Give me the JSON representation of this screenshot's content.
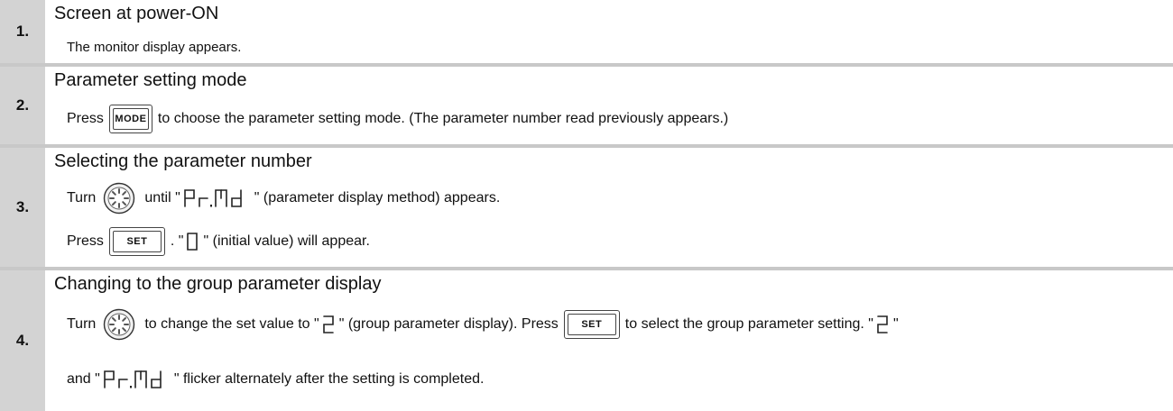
{
  "steps": [
    {
      "number": "1.",
      "title": "Screen at power-ON",
      "text": "The monitor display appears."
    },
    {
      "number": "2.",
      "title": "Parameter setting mode",
      "press_word": "Press",
      "button": "MODE",
      "text_after": "to choose the parameter setting mode. (The parameter number read previously appears.)"
    },
    {
      "number": "3.",
      "title": "Selecting the parameter number",
      "line1": {
        "turn_word": "Turn",
        "until_word": "until",
        "display": "Pr.Md",
        "text_after": "(parameter display method) appears."
      },
      "line2": {
        "press_word": "Press",
        "button": "SET",
        "dot": ".",
        "display": "0",
        "text_after": "(initial value) will appear."
      }
    },
    {
      "number": "4.",
      "title": "Changing to the group parameter display",
      "line1": {
        "turn_word": "Turn",
        "text_a": "to change the set value to",
        "display_a": "2",
        "text_b": "(group parameter display). Press",
        "button": "SET",
        "text_c": "to select the group parameter setting.",
        "display_b": "2"
      },
      "line2": {
        "and_word": "and",
        "display": "Pr.Md",
        "text_after": "flicker alternately after the setting is completed."
      }
    }
  ],
  "icons": [
    "dial-icon",
    "segment-display"
  ]
}
